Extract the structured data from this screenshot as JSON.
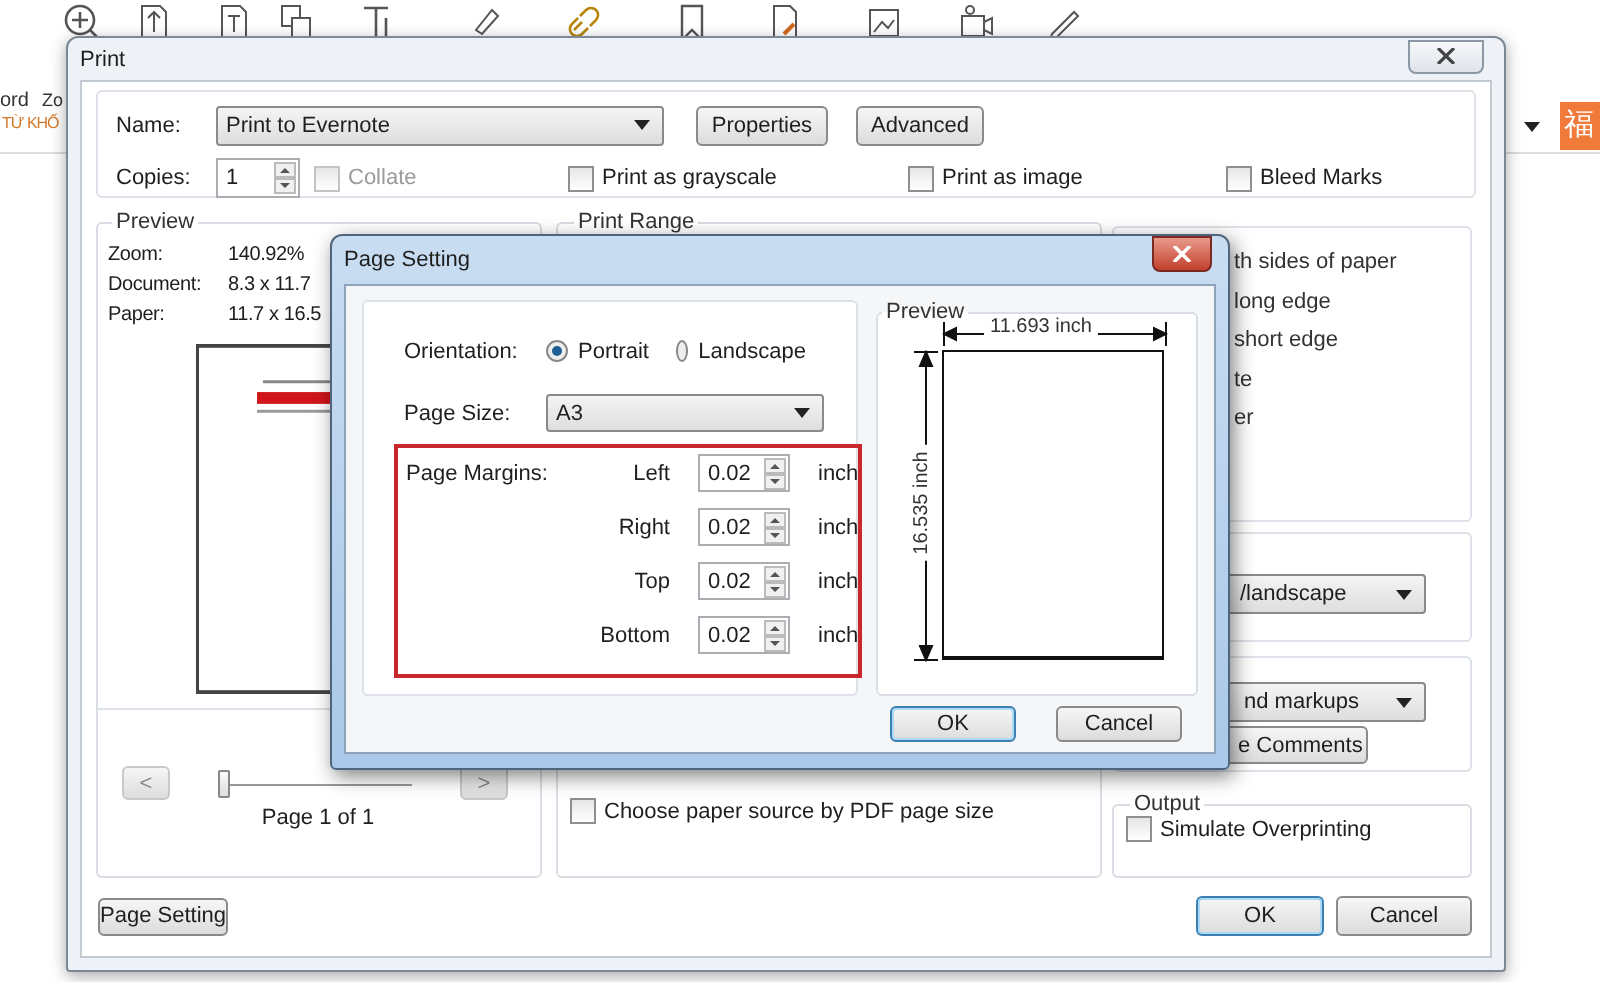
{
  "background": {
    "left_texts": [
      "ord",
      "Zo"
    ],
    "search_hint": "TỪ KHỐ",
    "orange_button": "福"
  },
  "print_dialog": {
    "title": "Print",
    "printer": {
      "label": "Name:",
      "value": "Print to Evernote"
    },
    "top_buttons": [
      "Properties",
      "Advanced"
    ],
    "copies": {
      "label": "Copies:",
      "value": "1"
    },
    "options": [
      {
        "label": "Collate",
        "checked": false,
        "disabled": true
      },
      {
        "label": "Print as grayscale",
        "checked": false,
        "disabled": false
      },
      {
        "label": "Print as image",
        "checked": false,
        "disabled": false
      },
      {
        "label": "Bleed Marks",
        "checked": false,
        "disabled": false
      }
    ],
    "preview": {
      "title": "Preview",
      "info": [
        {
          "label": "Zoom:",
          "value": "140.92%"
        },
        {
          "label": "Document:",
          "value": "8.3 x 11.7"
        },
        {
          "label": "Paper:",
          "value": "11.7 x 16.5"
        }
      ],
      "prev": "<",
      "next": ">",
      "slider": {
        "level": 0
      },
      "page": "Page 1 of 1"
    },
    "print_range": {
      "title": "Print Range",
      "options": [
        {
          "label": "Choose paper source by PDF page size",
          "checked": false
        }
      ]
    },
    "duplex_lines": [
      "th sides of paper",
      "long edge",
      "short edge",
      "te",
      "er"
    ],
    "orientation_select": "/landscape",
    "comments": {
      "select": "nd markups",
      "button": "e Comments"
    },
    "output": {
      "title": "Output",
      "options": [
        {
          "label": "Simulate Overprinting",
          "checked": false
        }
      ]
    },
    "page_setting_button": "Page Setting",
    "buttons": [
      {
        "label": "OK",
        "default": true
      },
      {
        "label": "Cancel",
        "default": false
      }
    ]
  },
  "page_setting": {
    "title": "Page Setting",
    "orientation": {
      "label": "Orientation:",
      "options": [
        {
          "label": "Portrait",
          "selected": true
        },
        {
          "label": "Landscape",
          "selected": false
        }
      ]
    },
    "page_size": {
      "label": "Page Size:",
      "value": "A3"
    },
    "margins": {
      "label": "Page Margins:",
      "rows": [
        {
          "label": "Left",
          "value": "0.02",
          "unit": "inch"
        },
        {
          "label": "Right",
          "value": "0.02",
          "unit": "inch"
        },
        {
          "label": "Top",
          "value": "0.02",
          "unit": "inch"
        },
        {
          "label": "Bottom",
          "value": "0.02",
          "unit": "inch"
        }
      ]
    },
    "preview": {
      "title": "Preview",
      "width": "11.693 inch",
      "height": "16.535 inch"
    },
    "buttons": [
      {
        "label": "OK",
        "default": true
      },
      {
        "label": "Cancel",
        "default": false
      }
    ]
  }
}
